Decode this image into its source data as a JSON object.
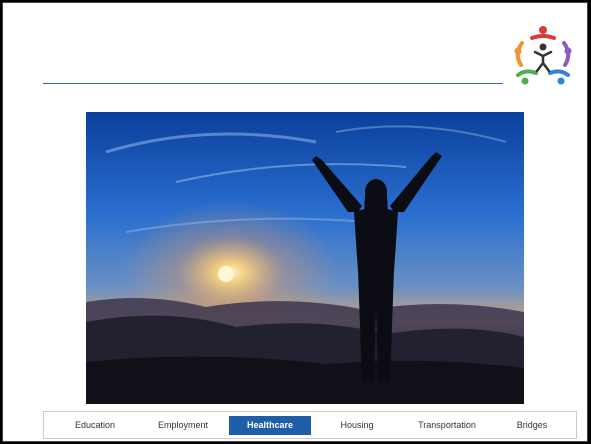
{
  "nav": {
    "items": [
      {
        "label": "Education"
      },
      {
        "label": "Employment"
      },
      {
        "label": "Healthcare",
        "active": true
      },
      {
        "label": "Housing"
      },
      {
        "label": "Transportation"
      },
      {
        "label": "Bridges"
      }
    ]
  },
  "colors": {
    "accent": "#1f5ea8",
    "rule": "#2b6cb5",
    "logo_red": "#d93a3a",
    "logo_orange": "#f0932b",
    "logo_purple": "#8e5bbf",
    "logo_green": "#4caf50",
    "logo_blue": "#2f86d6"
  },
  "logo": {
    "icon": "people-circle-logo"
  },
  "photo": {
    "subject": "silhouette-woman-arms-raised-sunset"
  }
}
